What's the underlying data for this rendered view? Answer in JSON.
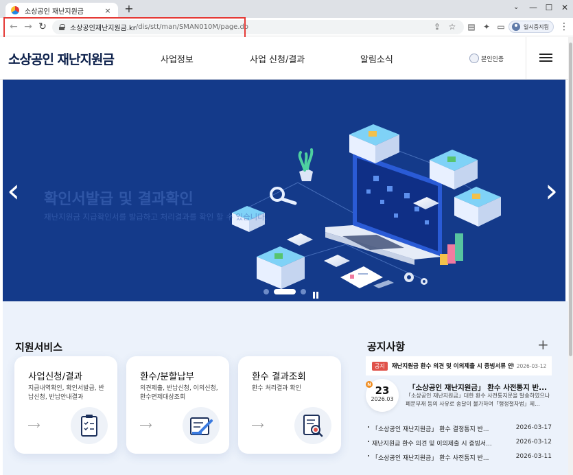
{
  "browser": {
    "tab_title": "소상공인 재난지원금",
    "tab_close": "×",
    "new_tab": "+",
    "tab_menu": "⌄",
    "minimize": "—",
    "maximize": "☐",
    "close": "✕",
    "back": "←",
    "forward": "→",
    "reload": "↻",
    "url_host": "소상공인재난지원금.kr",
    "url_path": "/dis/stt/man/SMAN010M/page.do",
    "profile_label": "일시중지됨",
    "share_icon": "⇪",
    "star_icon": "☆",
    "extension_icon": "✦",
    "sidepanel_icon": "▭",
    "cast_icon": "▤",
    "menu_icon": "⋮"
  },
  "header": {
    "logo": "소상공인 재난지원금",
    "nav": [
      "사업정보",
      "사업 신청/결과",
      "알림소식"
    ],
    "auth_label": "본인인증"
  },
  "hero": {
    "title": "확인서발급 및 결과확인",
    "subtitle": "재난지원금 지급확인서를 발급하고 처리결과를 확인 할 수 있습니다.",
    "prev": "‹",
    "next": "›",
    "slide_count": 3,
    "active_slide": 2
  },
  "services": {
    "title": "지원서비스",
    "cards": [
      {
        "title": "사업신청/결과",
        "desc": "지급내역확인, 확인서발급, 반납신청, 반납안내결과",
        "icon": "clipboard-icon"
      },
      {
        "title": "환수/분할납부",
        "desc": "의견제출, 반납신청, 이의신청, 환수면제대상조회",
        "icon": "document-edit-icon"
      },
      {
        "title": "환수 결과조회",
        "desc": "환수 처리결과 확인",
        "icon": "document-search-icon"
      }
    ]
  },
  "notices": {
    "title": "공지사항",
    "more": "+",
    "top": {
      "tag": "공지",
      "text": "재난지원금 환수 의견 및 이의제출 시 증빙서류 안내",
      "date": "2026-03-12"
    },
    "featured": {
      "badge": "N",
      "day": "23",
      "year_month": "2026.03",
      "title": "「소상공인 재난지원금」 환수 사전통지 반...",
      "desc": "「소상공인 재난지원금」대한 환수 사전통지문을 발송하였으나 폐문부재 등의 사유로 송달이 불가하여「행정절차법」제..."
    },
    "list": [
      {
        "text": "「소상공인 재난지원금」 환수 결정통지 반...",
        "date": "2026-03-17"
      },
      {
        "text": "재난지원금 환수 의견 및 이의제출 시 증빙서...",
        "date": "2026-03-12"
      },
      {
        "text": "「소상공인 재난지원금」 환수 사전통지 반...",
        "date": "2026-03-11"
      }
    ]
  },
  "colors": {
    "hero_bg": "#143a8a",
    "brand_navy": "#0b1f4a",
    "highlight_red": "#e53935",
    "notice_tag": "#e0524a",
    "new_badge": "#f08c1e"
  }
}
